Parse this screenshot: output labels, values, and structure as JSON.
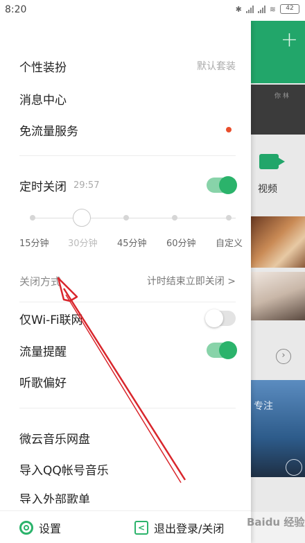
{
  "status_bar": {
    "time": "8:20",
    "battery": "42"
  },
  "drawer": {
    "theme": {
      "label": "个性装扮",
      "value": "默认套装"
    },
    "message_center": {
      "label": "消息中心"
    },
    "free_data": {
      "label": "免流量服务"
    },
    "sleep_timer": {
      "label": "定时关闭",
      "remaining": "29:57",
      "enabled": true
    },
    "timer_slider": {
      "options": [
        "15分钟",
        "30分钟",
        "45分钟",
        "60分钟",
        "自定义"
      ],
      "selected_index": 1
    },
    "close_mode": {
      "label": "关闭方式",
      "value": "计时结束立即关闭 >"
    },
    "wifi_only": {
      "label": "仅Wi-Fi联网",
      "enabled": false
    },
    "data_reminder": {
      "label": "流量提醒",
      "enabled": true
    },
    "listening_prefs": {
      "label": "听歌偏好"
    },
    "weiyun": {
      "label": "微云音乐网盘"
    },
    "import_qq": {
      "label": "导入QQ帐号音乐"
    },
    "import_external": {
      "label": "导入外部歌单"
    }
  },
  "footer": {
    "settings_label": "设置",
    "logout_label": "退出登录/关闭"
  },
  "background": {
    "video_label": "视频",
    "poster_text": "专注",
    "strip_text": "你 林"
  },
  "watermark": "Baidu 经验",
  "colors": {
    "accent": "#2bb36b",
    "badge": "#e94e2c",
    "annotation_arrow": "#d9262c"
  }
}
